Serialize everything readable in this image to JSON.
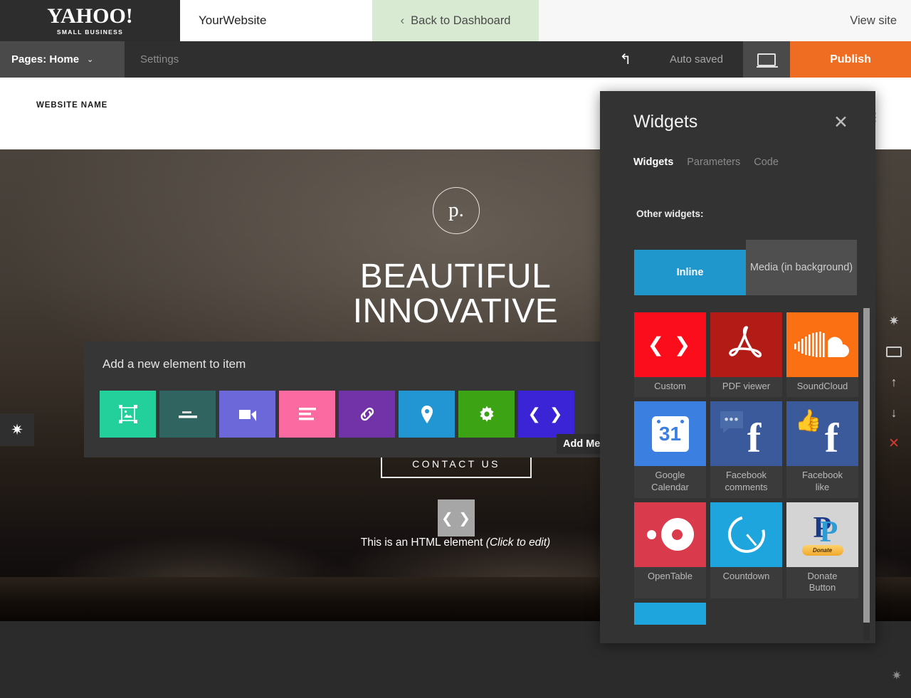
{
  "topbar": {
    "brand_main": "YAHOO!",
    "brand_sub": "SMALL BUSINESS",
    "site_name": "YourWebsite",
    "back_chevron": "‹",
    "back_label": "Back to Dashboard",
    "view_site": "View site"
  },
  "editbar": {
    "pages_label": "Pages: Home",
    "chevron": "⌄",
    "settings_label": "Settings",
    "undo_icon": "↰",
    "autosaved": "Auto saved",
    "preview_icon": "monitor-icon",
    "publish_label": "Publish",
    "publish_color": "#ef6d22"
  },
  "site": {
    "website_name": "WEBSITE NAME",
    "menu_dots": "⋮",
    "logo_mark": "p.",
    "headline_line1": "BEAUTIFUL",
    "headline_line2": "INNOVATIVE",
    "contact_button": "CONTACT US",
    "html_element_glyph": "❮ ❯",
    "html_element_caption": "This is an HTML element ",
    "html_element_caption_italic": "(Click to edit)"
  },
  "add_panel": {
    "title": "Add a new element to item",
    "tiles": [
      {
        "name": "image",
        "icon": "image-icon",
        "glyph": "🖼",
        "color": "#23cf9a"
      },
      {
        "name": "divider",
        "icon": "divider-icon",
        "glyph": "",
        "color": "#2f6460"
      },
      {
        "name": "video",
        "icon": "video-icon",
        "glyph": "",
        "color": "#6d68da"
      },
      {
        "name": "text",
        "icon": "text-icon",
        "glyph": "",
        "color": "#fb6ba1"
      },
      {
        "name": "link",
        "icon": "link-icon",
        "glyph": "🔗",
        "color": "#7333a8"
      },
      {
        "name": "map",
        "icon": "map-pin-icon",
        "glyph": "",
        "color": "#2196d3"
      },
      {
        "name": "widget",
        "icon": "gear-icon",
        "glyph": "✸",
        "color": "#3ca314"
      },
      {
        "name": "html",
        "icon": "code-icon",
        "glyph": "❮ ❯",
        "color": "#3b23d6"
      }
    ],
    "tooltip": "Add Media Widget"
  },
  "widgets_dialog": {
    "title": "Widgets",
    "close_icon": "✕",
    "tabs": [
      {
        "label": "Widgets",
        "active": true
      },
      {
        "label": "Parameters",
        "active": false
      },
      {
        "label": "Code",
        "active": false
      }
    ],
    "section_label": "Other widgets:",
    "segmented": {
      "inline": "Inline",
      "media": "Media (in background)",
      "active": "Inline",
      "active_color": "#1f97cc"
    },
    "grid": [
      [
        {
          "label": "Custom",
          "icon": "code-icon",
          "color": "#fc0d1b"
        },
        {
          "label": "PDF viewer",
          "icon": "pdf-icon",
          "color": "#b31b17"
        },
        {
          "label": "SoundCloud",
          "icon": "soundcloud-icon",
          "color": "#fb7012"
        }
      ],
      [
        {
          "label": "Google Calendar",
          "icon": "google-calendar-icon",
          "color": "#3b7fe0"
        },
        {
          "label": "Facebook comments",
          "icon": "facebook-comments-icon",
          "color": "#3b5a9b"
        },
        {
          "label": "Facebook like",
          "icon": "facebook-like-icon",
          "color": "#3b5a9b"
        }
      ],
      [
        {
          "label": "OpenTable",
          "icon": "opentable-icon",
          "color": "#da3b4c"
        },
        {
          "label": "Countdown",
          "icon": "countdown-icon",
          "color": "#1fa5dd"
        },
        {
          "label": "Donate Button",
          "icon": "paypal-donate-icon",
          "color": "#d4d4d4"
        }
      ]
    ],
    "grid_labels": {
      "r0c0": "Custom",
      "r0c1": "PDF viewer",
      "r0c2": "SoundCloud",
      "r1c0_a": "Google",
      "r1c0_b": "Calendar",
      "r1c1_a": "Facebook",
      "r1c1_b": "comments",
      "r1c2_a": "Facebook",
      "r1c2_b": "like",
      "r2c0": "OpenTable",
      "r2c1": "Countdown",
      "r2c2_a": "Donate",
      "r2c2_b": "Button"
    },
    "paypal_button_text": "Donate",
    "gcal_day": "31",
    "fb_letter": "f",
    "fbc_dots": "•••",
    "fbl_thumb": "👍",
    "pdf_letter": "A"
  },
  "rails": {
    "right_icons": [
      "gear-icon",
      "monitor-icon",
      "arrow-up-icon",
      "arrow-down-icon",
      "close-icon"
    ],
    "gear_glyph": "✷",
    "up_glyph": "↑",
    "down_glyph": "↓",
    "x_glyph": "✕",
    "left_gear_glyph": "✷",
    "bottom_gear_glyph": "✷"
  }
}
